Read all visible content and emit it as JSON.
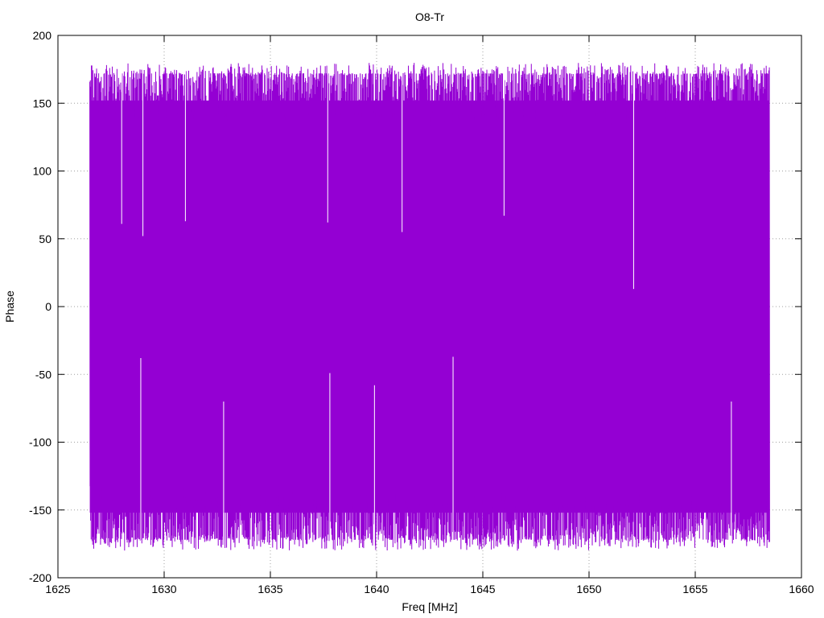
{
  "chart_data": {
    "type": "line",
    "title": "O8-Tr",
    "xlabel": "Freq [MHz]",
    "ylabel": "Phase",
    "xlim": [
      1625,
      1660
    ],
    "ylim": [
      -200,
      200
    ],
    "xticks": [
      1625,
      1630,
      1635,
      1640,
      1645,
      1650,
      1655,
      1660
    ],
    "yticks": [
      -200,
      -150,
      -100,
      -50,
      0,
      50,
      100,
      150,
      200
    ],
    "grid": true,
    "grid_style": "dotted",
    "series": [
      {
        "color": "#9400d3",
        "x_start": 1626.5,
        "x_end": 1658.5,
        "phase_range": [
          -180,
          180
        ],
        "description_values": {
          "typical_max": 172,
          "typical_min": -172,
          "notable_upper_dips": [
            {
              "x": 1628.0,
              "y": 61
            },
            {
              "x": 1629.0,
              "y": 52
            },
            {
              "x": 1631.0,
              "y": 63
            },
            {
              "x": 1637.7,
              "y": 62
            },
            {
              "x": 1641.2,
              "y": 55
            },
            {
              "x": 1646.0,
              "y": 67
            },
            {
              "x": 1652.1,
              "y": 13
            }
          ],
          "notable_lower_peaks": [
            {
              "x": 1628.9,
              "y": -38
            },
            {
              "x": 1637.8,
              "y": -49
            },
            {
              "x": 1639.9,
              "y": -58
            },
            {
              "x": 1643.6,
              "y": -37
            },
            {
              "x": 1656.7,
              "y": -70
            },
            {
              "x": 1632.8,
              "y": -70
            }
          ]
        }
      }
    ]
  }
}
